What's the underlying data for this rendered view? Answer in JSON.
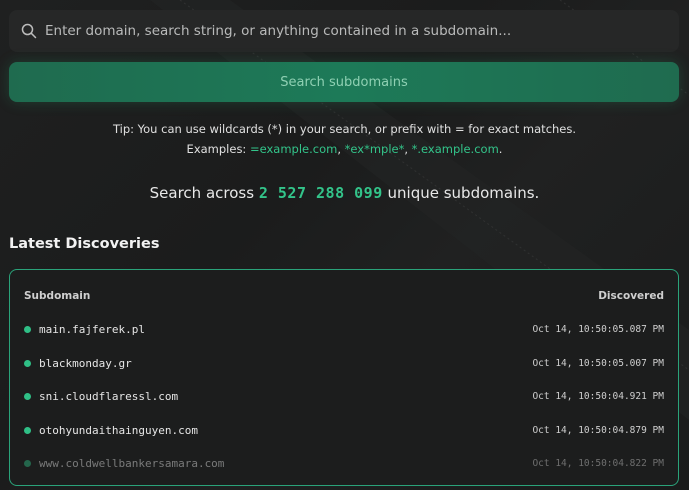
{
  "search": {
    "placeholder": "Enter domain, search string, or anything contained in a subdomain...",
    "value": "",
    "button_label": "Search subdomains"
  },
  "tip": {
    "line1": "Tip: You can use wildcards (*) in your search, or prefix with = for exact matches.",
    "examples_label": "Examples:",
    "examples": [
      "=example.com",
      "*ex*mple*",
      "*.example.com"
    ],
    "sep": ", ",
    "end": "."
  },
  "stats": {
    "prefix": "Search across",
    "count": "2 527 288 099",
    "suffix": "unique subdomains."
  },
  "latest": {
    "title": "Latest Discoveries",
    "col_subdomain": "Subdomain",
    "col_discovered": "Discovered",
    "rows": [
      {
        "subdomain": "main.fajferek.pl",
        "discovered": "Oct 14, 10:50:05.087 PM"
      },
      {
        "subdomain": "blackmonday.gr",
        "discovered": "Oct 14, 10:50:05.007 PM"
      },
      {
        "subdomain": "sni.cloudflaressl.com",
        "discovered": "Oct 14, 10:50:04.921 PM"
      },
      {
        "subdomain": "otohyundaithainguyen.com",
        "discovered": "Oct 14, 10:50:04.879 PM"
      },
      {
        "subdomain": "www.coldwellbankersamara.com",
        "discovered": "Oct 14, 10:50:04.822 PM"
      }
    ]
  },
  "colors": {
    "accent": "#33c48a",
    "border": "#2aa37a"
  }
}
